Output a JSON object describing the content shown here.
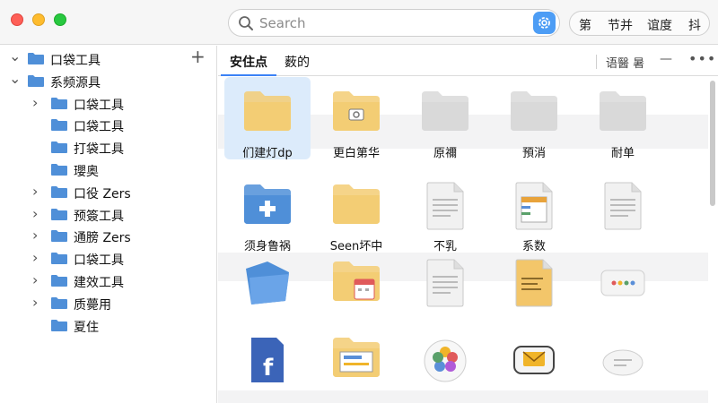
{
  "search": {
    "placeholder": "Search"
  },
  "toolbar_segments": [
    "第",
    "节并",
    "谊度",
    "抖"
  ],
  "sidebar": {
    "items": [
      {
        "label": "口袋工具",
        "chevron": "down",
        "indent": 0
      },
      {
        "label": "系频源具",
        "chevron": "down",
        "indent": 0
      },
      {
        "label": "口袋工具",
        "chevron": "right",
        "indent": 1
      },
      {
        "label": "口袋工具",
        "chevron": "",
        "indent": 1
      },
      {
        "label": "打袋工具",
        "chevron": "",
        "indent": 1
      },
      {
        "label": "瓔奥",
        "chevron": "",
        "indent": 1
      },
      {
        "label": "口役 Zers",
        "chevron": "right",
        "indent": 1
      },
      {
        "label": "预簽工具",
        "chevron": "right",
        "indent": 1
      },
      {
        "label": "通膀 Zers",
        "chevron": "right",
        "indent": 1
      },
      {
        "label": "口袋工具",
        "chevron": "right",
        "indent": 1
      },
      {
        "label": "建效工具",
        "chevron": "right",
        "indent": 1
      },
      {
        "label": "质薨用",
        "chevron": "right",
        "indent": 1
      },
      {
        "label": "夏住",
        "chevron": "",
        "indent": 1
      }
    ]
  },
  "tabs": [
    {
      "label": "安住点",
      "active": true
    },
    {
      "label": "薮的",
      "active": false
    }
  ],
  "tabbar_right": {
    "label": "语醫 暑",
    "dash": "—",
    "more": "•••"
  },
  "grid": [
    {
      "caption": "们建灯dp",
      "icon": "folder",
      "selected": true
    },
    {
      "caption": "更白第华",
      "icon": "folder-camera"
    },
    {
      "caption": "原禰",
      "icon": "folder-gray"
    },
    {
      "caption": "預消",
      "icon": "folder-gray"
    },
    {
      "caption": "耐单",
      "icon": "folder-gray"
    },
    {
      "caption": "须身鲁祸",
      "icon": "folder-blue-plus"
    },
    {
      "caption": "Seen坏中",
      "icon": "folder"
    },
    {
      "caption": "不乳",
      "icon": "document"
    },
    {
      "caption": "系数",
      "icon": "document-table"
    },
    {
      "caption": "",
      "icon": "document"
    },
    {
      "caption": "",
      "icon": "folder-blue-open"
    },
    {
      "caption": "",
      "icon": "folder-calendar"
    },
    {
      "caption": "",
      "icon": "document"
    },
    {
      "caption": "",
      "icon": "document-yellow"
    },
    {
      "caption": "",
      "icon": "dots-card"
    },
    {
      "caption": "",
      "icon": "facebook-doc"
    },
    {
      "caption": "",
      "icon": "folder-slides"
    },
    {
      "caption": "",
      "icon": "photos-app"
    },
    {
      "caption": "",
      "icon": "mail-card"
    },
    {
      "caption": "",
      "icon": "chat-card"
    }
  ],
  "colors": {
    "accent": "#3b82f6",
    "folder": "#f3cd74",
    "folder_blue": "#4f8fd8"
  }
}
